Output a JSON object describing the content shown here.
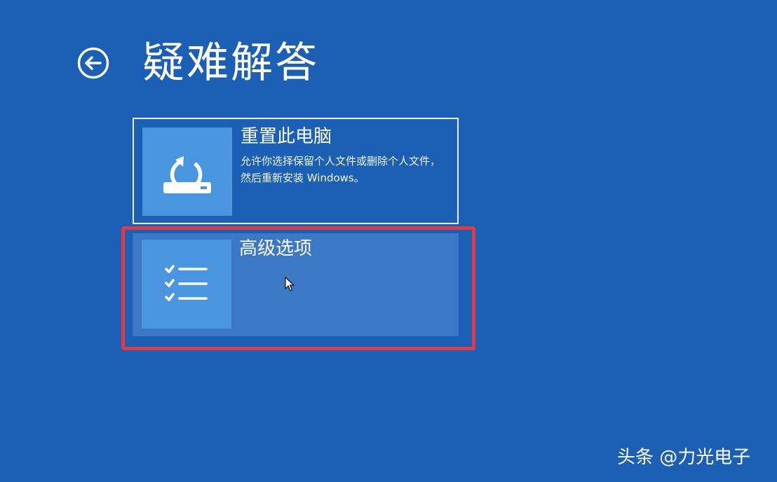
{
  "header": {
    "back_icon": "back-arrow-circle-icon",
    "title": "疑难解答"
  },
  "options": [
    {
      "icon": "reset-pc-icon",
      "title": "重置此电脑",
      "description": "允许你选择保留个人文件或删除个人文件，然后重新安装 Windows。"
    },
    {
      "icon": "checklist-icon",
      "title": "高级选项",
      "selected": true
    }
  ],
  "watermark": {
    "text": "头条 @力光电子"
  },
  "colors": {
    "background": "#1b60b5",
    "tile_icon_background": "#4a95df",
    "tile_hover_background": "#3b78c6",
    "tile_border": "#e9eef7",
    "highlight_annotation": "#e03a46"
  }
}
